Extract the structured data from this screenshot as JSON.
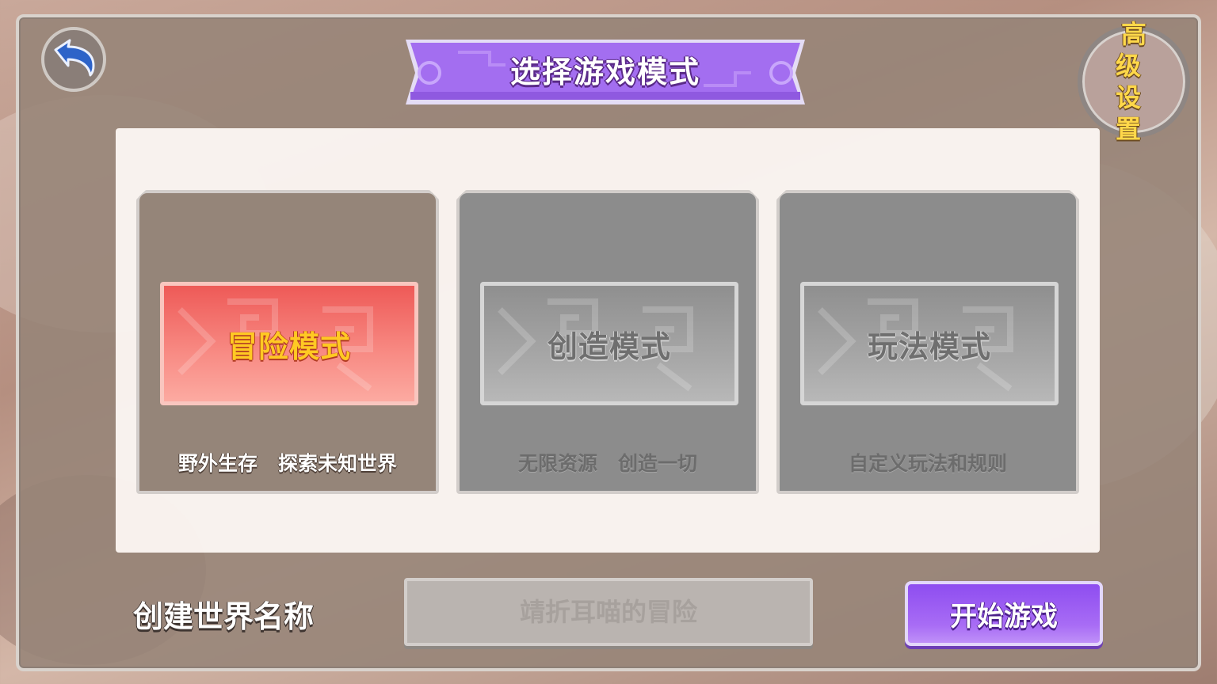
{
  "header": {
    "title": "选择游戏模式",
    "advanced_settings": "高级设置"
  },
  "modes": [
    {
      "label": "冒险模式",
      "description": "野外生存   探索未知世界",
      "selected": true
    },
    {
      "label": "创造模式",
      "description": "无限资源   创造一切",
      "selected": false
    },
    {
      "label": "玩法模式",
      "description": "自定义玩法和规则",
      "selected": false
    }
  ],
  "footer": {
    "world_name_label": "创建世界名称",
    "world_name_placeholder": "靖折耳喵的冒险",
    "start_button": "开始游戏"
  },
  "colors": {
    "title_banner": "#a36ef0",
    "selected_mode": "#f07a74",
    "selected_mode_text": "#ffc923",
    "start_button": "#9b5ef2",
    "advanced_text": "#ffd84a"
  },
  "icons": {
    "back": "back-arrow-icon"
  }
}
